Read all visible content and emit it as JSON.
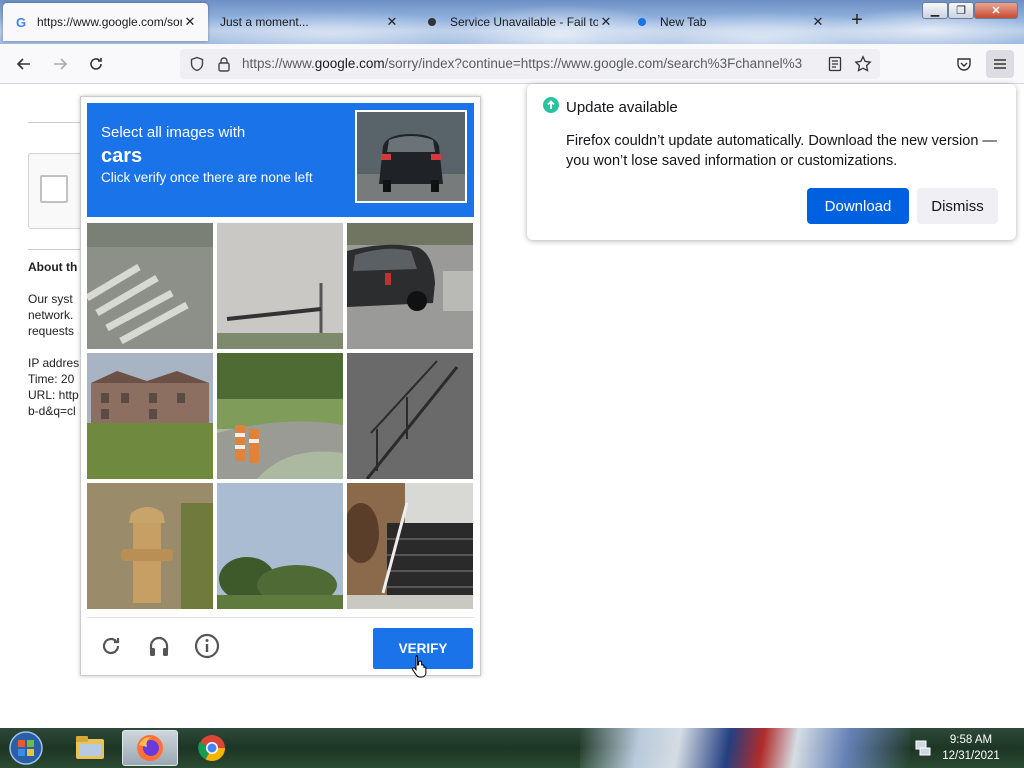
{
  "browser": {
    "tabs": [
      {
        "title": "https://www.google.com/sorry/index?continue=https://www.google.com/search",
        "active": true
      },
      {
        "title": "Just a moment...",
        "active": false
      },
      {
        "title": "Service Unavailable - Fail to connect",
        "active": false
      },
      {
        "title": "New Tab",
        "active": false
      }
    ],
    "url_prefix": "https://www.",
    "url_domain": "google.com",
    "url_rest": "/sorry/index?continue=https://www.google.com/search%3Fchannel%3"
  },
  "page": {
    "about_heading": "About th",
    "lines": [
      "Our syst",
      "network.",
      "requests",
      "",
      "IP addres",
      "Time: 20",
      "URL: http",
      "b-d&q=cl"
    ]
  },
  "captcha": {
    "instruction": "Select all images with",
    "target": "cars",
    "hint": "Click verify once there are none left",
    "verify_label": "VERIFY",
    "tiles": [
      {
        "name": "crosswalk-tile"
      },
      {
        "name": "traffic-pole-tile"
      },
      {
        "name": "car-tile"
      },
      {
        "name": "building-tile"
      },
      {
        "name": "road-cones-tile"
      },
      {
        "name": "stairs-railing-tile"
      },
      {
        "name": "hydrant-tile"
      },
      {
        "name": "trees-sky-tile"
      },
      {
        "name": "steps-tile"
      }
    ]
  },
  "update_popup": {
    "title": "Update available",
    "body": "Firefox couldn’t update automatically. Download the new version — you won’t lose saved information or customizations.",
    "download_label": "Download",
    "dismiss_label": "Dismiss",
    "accent": "#0061e0"
  },
  "taskbar": {
    "time": "9:58 AM",
    "date": "12/31/2021"
  }
}
